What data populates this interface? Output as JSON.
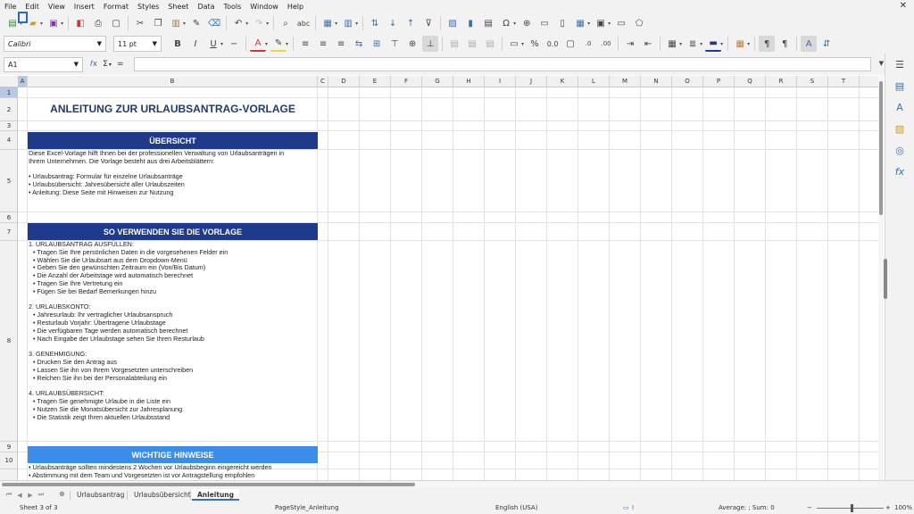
{
  "menubar": {
    "items": [
      "File",
      "Edit",
      "View",
      "Insert",
      "Format",
      "Styles",
      "Sheet",
      "Data",
      "Tools",
      "Window",
      "Help"
    ],
    "close": "✕"
  },
  "toolbar2": {
    "font_name": "Calibri",
    "font_size": "11 pt"
  },
  "formulabar": {
    "cell_ref": "A1",
    "fx": "𝑓x",
    "sigma": "Σ",
    "equals": "=",
    "value": ""
  },
  "columns": [
    "A",
    "B",
    "C",
    "D",
    "E",
    "F",
    "G",
    "H",
    "I",
    "J",
    "K",
    "L",
    "M",
    "N",
    "O",
    "P",
    "Q",
    "R",
    "S",
    "T"
  ],
  "rows": [
    "1",
    "2",
    "3",
    "4",
    "5",
    "6",
    "7",
    "8",
    "9",
    "10"
  ],
  "sheet": {
    "title": "ANLEITUNG ZUR URLAUBSANTRAG-VORLAGE",
    "sec1": "ÜBERSICHT",
    "overview": [
      "Diese Excel-Vorlage hilft Ihnen bei der professionellen Verwaltung von Urlaubsanträgen in",
      "Ihrem Unternehmen. Die Vorlage besteht aus drei Arbeitsblättern:",
      "",
      "• Urlaubsantrag: Formular für einzelne Urlaubsanträge",
      "• Urlaubsübersicht: Jahresübersicht aller Urlaubszeiten",
      "• Anleitung: Diese Seite mit Hinweisen zur Nutzung"
    ],
    "sec2": "SO VERWENDEN SIE DIE VORLAGE",
    "howto": [
      "1. URLAUBSANTRAG AUSFÜLLEN:",
      "  • Tragen Sie Ihre persönlichen Daten in die vorgesehenen Felder ein",
      "  • Wählen Sie die Urlaubsart aus dem Dropdown-Menü",
      "  • Geben Sie den gewünschten Zeitraum ein (Von/Bis Datum)",
      "  • Die Anzahl der Arbeitstage wird automatisch berechnet",
      "  • Tragen Sie Ihre Vertretung ein",
      "  • Fügen Sie bei Bedarf Bemerkungen hinzu",
      "",
      "2. URLAUBSKONTO:",
      "  • Jahresurlaub: Ihr vertraglicher Urlaubsanspruch",
      "  • Resturlaub Vorjahr: Übertragene Urlaubstage",
      "  • Die verfügbaren Tage werden automatisch berechnet",
      "  • Nach Eingabe der Urlaubstage sehen Sie Ihren Resturlaub",
      "",
      "3. GENEHMIGUNG:",
      "  • Drucken Sie den Antrag aus",
      "  • Lassen Sie ihn von Ihrem Vorgesetzten unterschreiben",
      "  • Reichen Sie ihn bei der Personalabteilung ein",
      "",
      "4. URLAUBSÜBERSICHT:",
      "  • Tragen Sie genehmigte Urlaube in die Liste ein",
      "  • Nutzen Sie die Monatsübersicht zur Jahresplanung",
      "  • Die Statistik zeigt Ihren aktuellen Urlaubsstand"
    ],
    "sec3": "WICHTIGE HINWEISE",
    "notes": [
      "• Urlaubsanträge sollten mindestens 2 Wochen vor Urlaubsbeginn eingereicht werden",
      "• Abstimmung mit dem Team und Vorgesetzten ist vor Antragstellung empfohlen"
    ]
  },
  "tabs": {
    "add": "⊕",
    "items": [
      "Urlaubsantrag",
      "Urlaubsübersicht",
      "Anleitung"
    ],
    "active": "Anleitung"
  },
  "statusbar": {
    "sheet": "Sheet 3 of 3",
    "style": "PageStyle_Anleitung",
    "lang": "English (USA)",
    "summary": "Average: ; Sum: 0",
    "zoom_minus": "−",
    "zoom_plus": "+",
    "zoom": "100%"
  },
  "colors": {
    "dark_header": "#1f3a8a",
    "light_header": "#3a8eea",
    "title": "#1f3a6e",
    "accent": "#3a6fb0"
  }
}
